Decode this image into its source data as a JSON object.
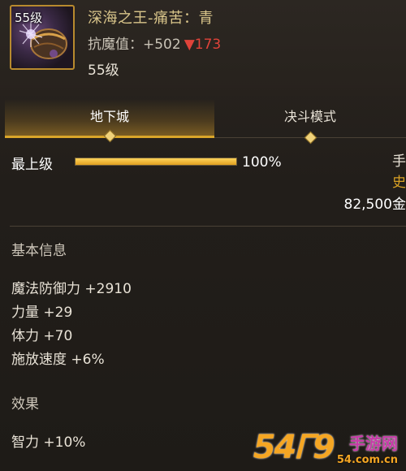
{
  "item": {
    "icon": "armor-piece-icon",
    "level_tag": "55级",
    "name": "深海之王-痛苦：青",
    "stat_label": "抗魔值：",
    "stat_value": "+502",
    "stat_change_arrow": "▼",
    "stat_change": "173",
    "level": "55级"
  },
  "tabs": [
    {
      "label": "地下城",
      "active": true
    },
    {
      "label": "决斗模式",
      "active": false
    }
  ],
  "upgrade": {
    "label": "最上级",
    "progress_percent": 100,
    "progress_text": "100%"
  },
  "side_info": {
    "line1": "手",
    "line2": "史",
    "price": "82,500金"
  },
  "basic_info": {
    "title": "基本信息",
    "attributes": [
      "魔法防御力 +2910",
      "力量 +29",
      "体力 +70",
      "施放速度 +6%"
    ]
  },
  "effects": {
    "title": "效果",
    "attributes": [
      "智力 +10%"
    ]
  },
  "watermark": {
    "number": "54",
    "glyph": "Ꮁ9",
    "name": "手游网",
    "url": "54.com.cn"
  },
  "colors": {
    "accent_gold": "#d9a52a",
    "item_name": "#d9c58a",
    "stat_down": "#e0433a",
    "rarity": "#d8a024"
  }
}
